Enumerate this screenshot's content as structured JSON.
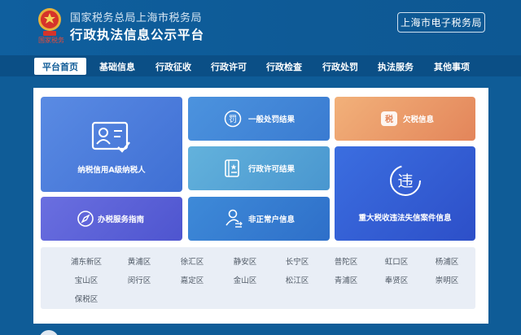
{
  "header": {
    "emblem_caption": "国家税务",
    "title_sub": "国家税务总局上海市税务局",
    "title_main": "行政执法信息公示平台",
    "bureau_button": "上海市电子税务局"
  },
  "nav": {
    "items": [
      {
        "label": "平台首页",
        "active": true
      },
      {
        "label": "基础信息"
      },
      {
        "label": "行政征收"
      },
      {
        "label": "行政许可"
      },
      {
        "label": "行政检查"
      },
      {
        "label": "行政处罚"
      },
      {
        "label": "执法服务"
      },
      {
        "label": "其他事项"
      }
    ]
  },
  "tiles": {
    "credit": {
      "label": "纳税信用A级纳税人",
      "icon": "id-card-check-icon"
    },
    "general_penalty": {
      "label": "一般处罚结果",
      "icon": "penalty-seal-icon",
      "icon_text": "罚"
    },
    "arrears": {
      "label": "欠税信息",
      "icon": "tax-arrears-icon",
      "icon_text": "税"
    },
    "permit": {
      "label": "行政许可结果",
      "icon": "permit-book-icon"
    },
    "major_case": {
      "label": "重大税收违法失信案件信息",
      "icon": "violation-icon",
      "icon_text": "违"
    },
    "guide": {
      "label": "办税服务指南",
      "icon": "compass-icon"
    },
    "abnormal": {
      "label": "非正常户信息",
      "icon": "user-exchange-icon"
    }
  },
  "districts": [
    "浦东新区",
    "黄浦区",
    "徐汇区",
    "静安区",
    "长宁区",
    "普陀区",
    "虹口区",
    "杨浦区",
    "宝山区",
    "闵行区",
    "嘉定区",
    "金山区",
    "松江区",
    "青浦区",
    "奉贤区",
    "崇明区",
    "保税区"
  ],
  "colors": {
    "header_bg": "#0f5f9e",
    "nav_bg": "#0b4f86",
    "active_tab_text": "#0d5a96",
    "district_bg": "#e9eef6"
  }
}
